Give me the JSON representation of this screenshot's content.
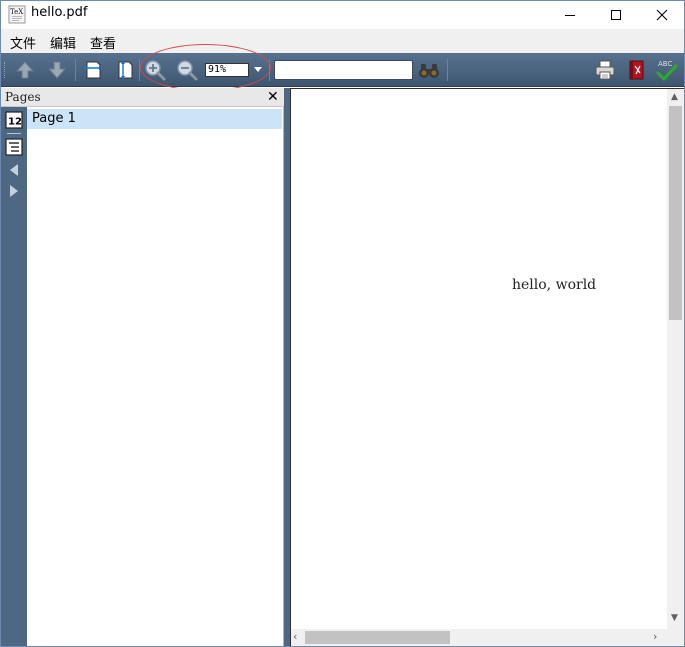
{
  "window": {
    "title": "hello.pdf",
    "app_icon": "tex-icon",
    "controls": [
      "minimize-icon",
      "maximize-icon",
      "close-icon"
    ]
  },
  "menu": {
    "items": [
      {
        "label": "文件"
      },
      {
        "label": "编辑"
      },
      {
        "label": "查看"
      }
    ]
  },
  "toolbar": {
    "buttons": [
      {
        "icon": "arrow-up-icon",
        "label": "Previous Page"
      },
      {
        "icon": "arrow-down-icon",
        "label": "Next Page"
      },
      {
        "icon": "fit-width-icon",
        "label": "Fit to Width"
      },
      {
        "icon": "fit-page-icon",
        "label": "Fit to Page"
      },
      {
        "icon": "zoom-in-icon",
        "label": "Zoom In"
      },
      {
        "icon": "zoom-out-icon",
        "label": "Zoom Out"
      },
      {
        "icon": "binoculars-icon",
        "label": "Find"
      },
      {
        "icon": "printer-icon",
        "label": "Print"
      },
      {
        "icon": "pdf-book-icon",
        "label": "Open"
      },
      {
        "icon": "spellcheck-icon",
        "label": "Spell Check"
      }
    ],
    "zoom_value": "91%",
    "search_value": ""
  },
  "sidebar": {
    "tabs": [
      {
        "icon": "page-number-icon",
        "label": "12"
      },
      {
        "icon": "outline-list-icon"
      },
      {
        "icon": "collapse-left-icon"
      },
      {
        "icon": "expand-right-icon"
      }
    ]
  },
  "pages_panel": {
    "title": "Pages",
    "close_glyph": "✕",
    "pages": [
      {
        "label": "Page 1",
        "selected": true
      }
    ]
  },
  "document": {
    "text": "hello, world"
  },
  "colors": {
    "toolbar": "#4a6482",
    "selection": "#cce4f7",
    "annotation": "#d44a4a"
  }
}
